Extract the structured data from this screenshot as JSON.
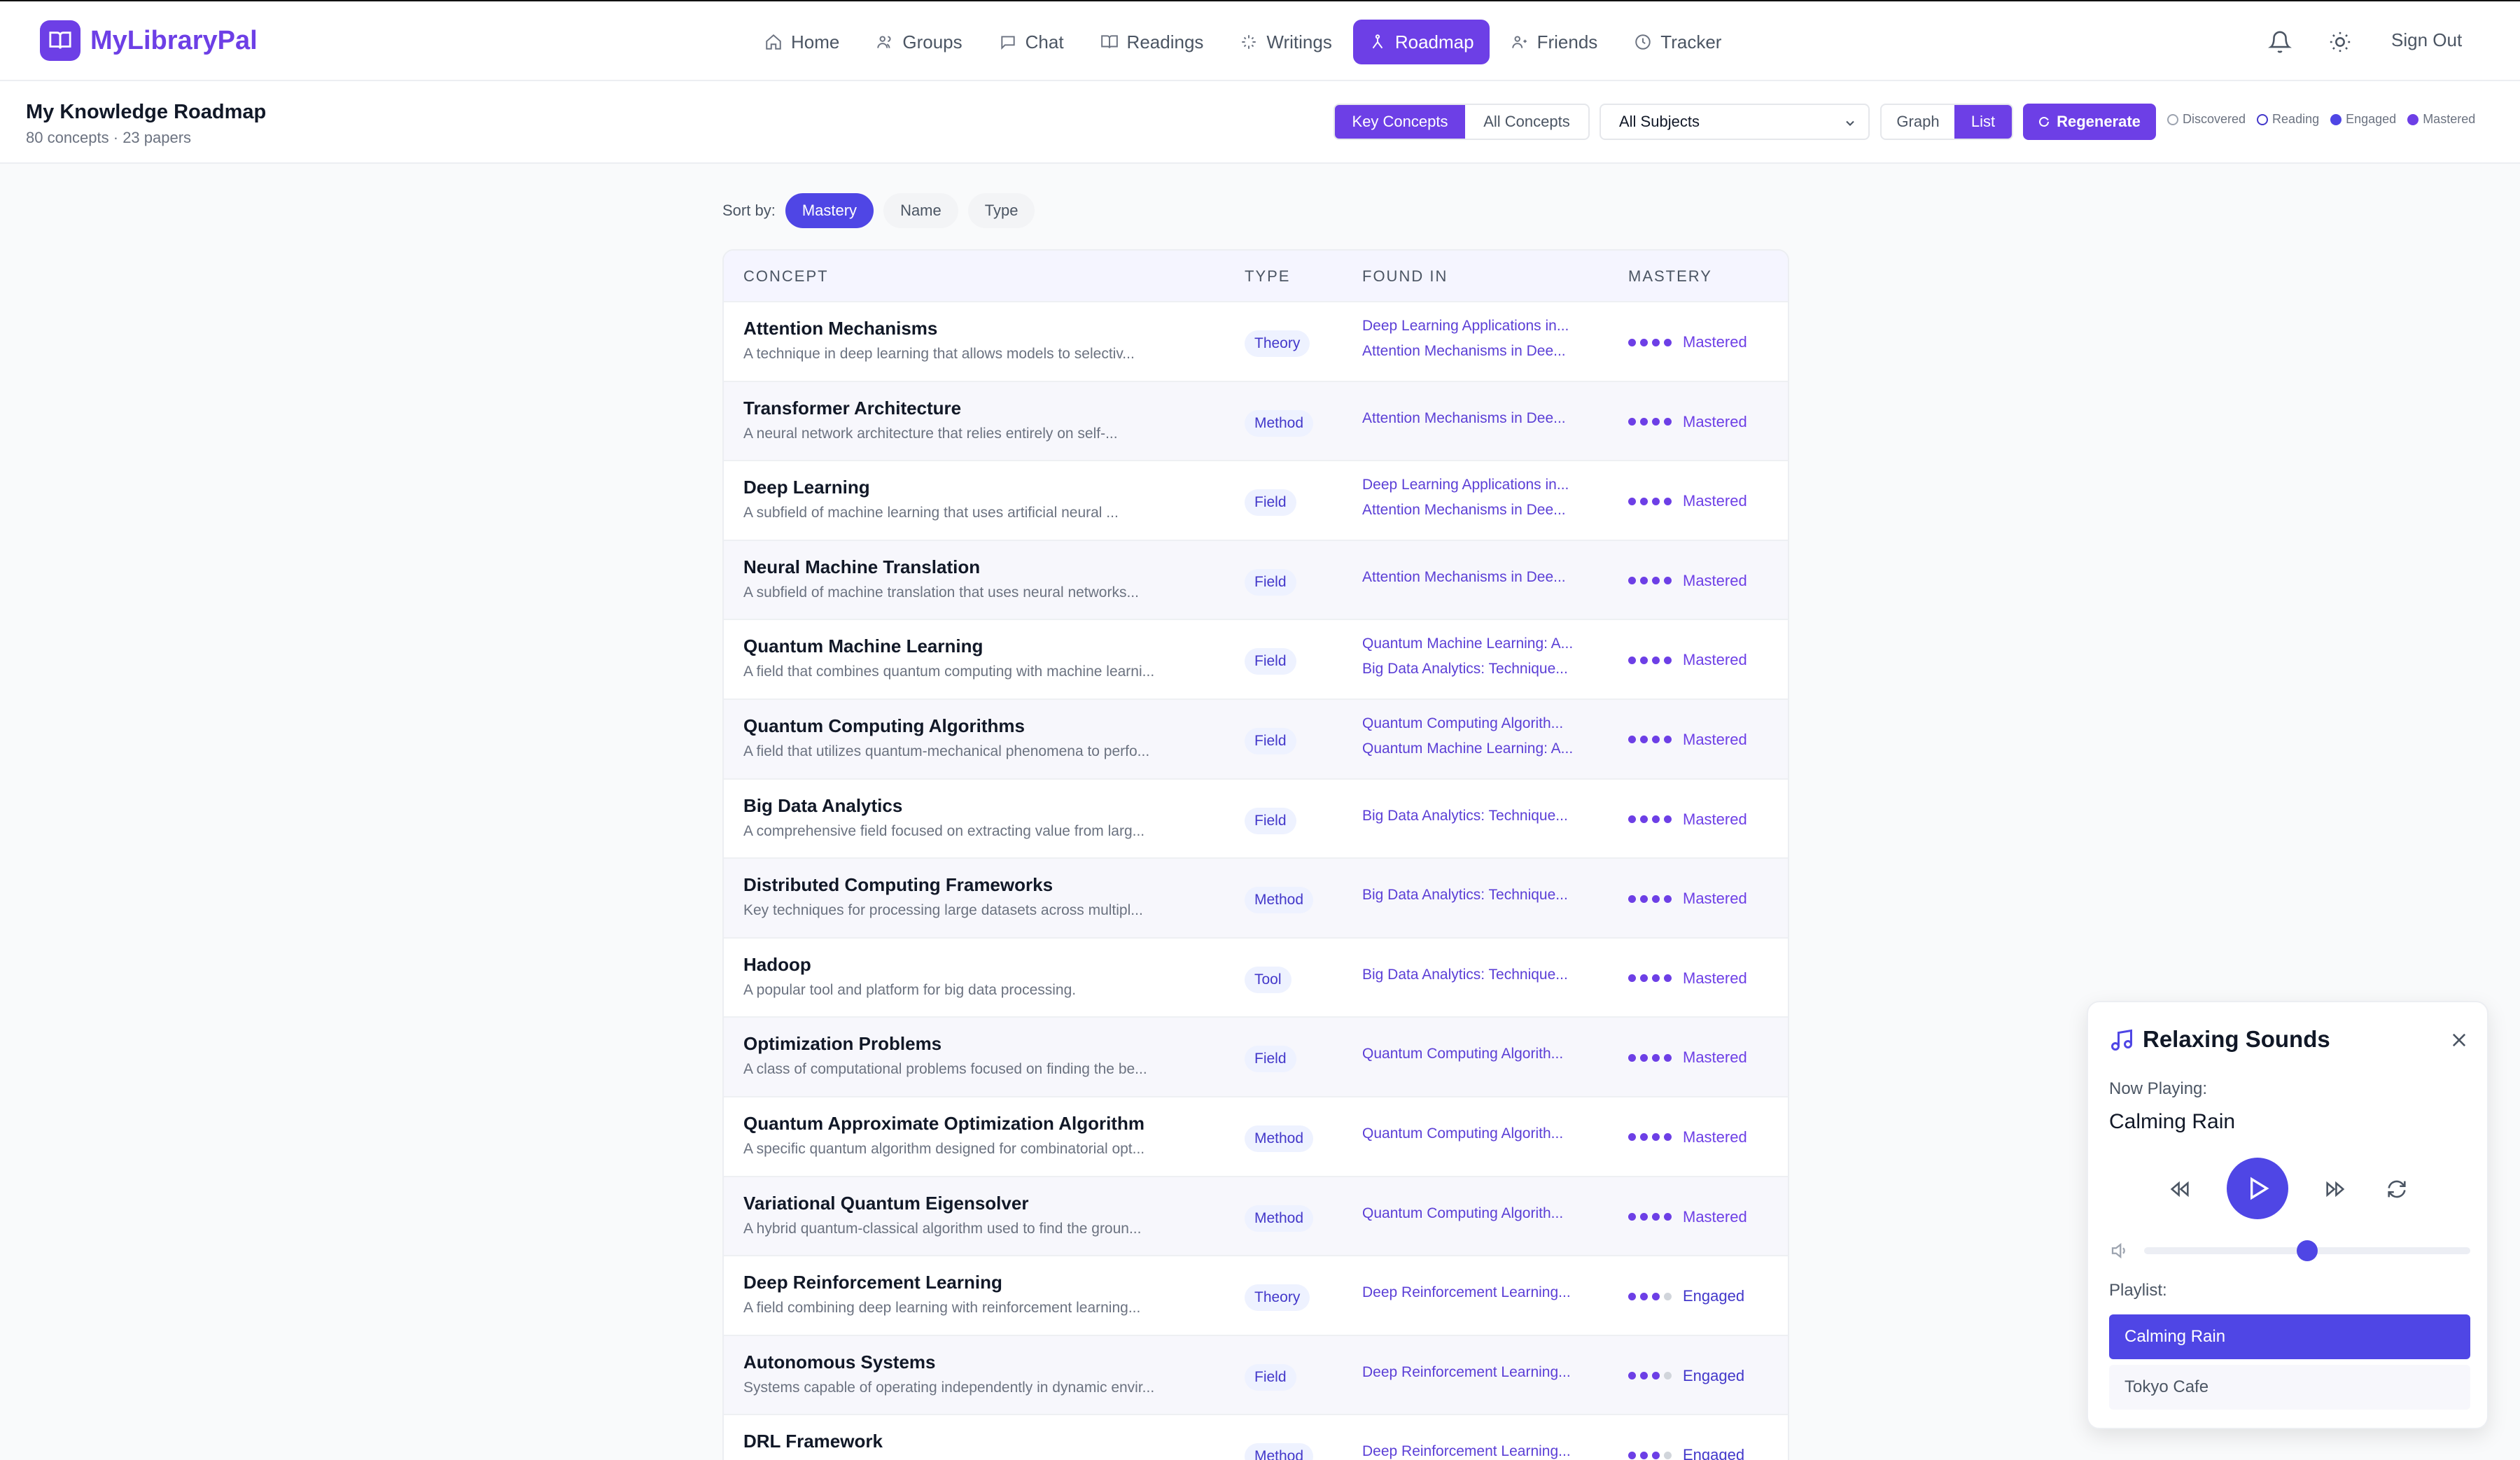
{
  "app": {
    "name": "MyLibraryPal"
  },
  "nav": [
    {
      "label": "Home",
      "icon": "home-icon"
    },
    {
      "label": "Groups",
      "icon": "groups-icon"
    },
    {
      "label": "Chat",
      "icon": "chat-icon"
    },
    {
      "label": "Readings",
      "icon": "book-icon"
    },
    {
      "label": "Writings",
      "icon": "sparkle-icon"
    },
    {
      "label": "Roadmap",
      "icon": "roadmap-icon",
      "active": true
    },
    {
      "label": "Friends",
      "icon": "friends-icon"
    },
    {
      "label": "Tracker",
      "icon": "clock-icon"
    }
  ],
  "header": {
    "sign_out": "Sign Out"
  },
  "page": {
    "title": "My Knowledge Roadmap",
    "subtitle": "80 concepts · 23 papers",
    "filter_key": "Key Concepts",
    "filter_all": "All Concepts",
    "subject_select": "All Subjects",
    "view_graph": "Graph",
    "view_list": "List",
    "regenerate": "Regenerate",
    "legend": [
      {
        "label": "Discovered",
        "color": "#9ca3af"
      },
      {
        "label": "Reading",
        "color": "#4338ca"
      },
      {
        "label": "Engaged",
        "color": "#4f46e5"
      },
      {
        "label": "Mastered",
        "color": "#6d3fe6"
      }
    ]
  },
  "sort": {
    "label": "Sort by:",
    "options": [
      "Mastery",
      "Name",
      "Type"
    ],
    "active": "Mastery"
  },
  "table": {
    "headers": [
      "CONCEPT",
      "TYPE",
      "FOUND IN",
      "MASTERY"
    ],
    "rows": [
      {
        "name": "Attention Mechanisms",
        "desc": "A technique in deep learning that allows models to selectiv...",
        "type": "Theory",
        "found": [
          "Deep Learning Applications in...",
          "Attention Mechanisms in Dee..."
        ],
        "level": 4,
        "mastery": "Mastered"
      },
      {
        "name": "Transformer Architecture",
        "desc": "A neural network architecture that relies entirely on self-...",
        "type": "Method",
        "found": [
          "Attention Mechanisms in Dee..."
        ],
        "level": 4,
        "mastery": "Mastered"
      },
      {
        "name": "Deep Learning",
        "desc": "A subfield of machine learning that uses artificial neural ...",
        "type": "Field",
        "found": [
          "Deep Learning Applications in...",
          "Attention Mechanisms in Dee..."
        ],
        "level": 4,
        "mastery": "Mastered"
      },
      {
        "name": "Neural Machine Translation",
        "desc": "A subfield of machine translation that uses neural networks...",
        "type": "Field",
        "found": [
          "Attention Mechanisms in Dee..."
        ],
        "level": 4,
        "mastery": "Mastered"
      },
      {
        "name": "Quantum Machine Learning",
        "desc": "A field that combines quantum computing with machine learni...",
        "type": "Field",
        "found": [
          "Quantum Machine Learning: A...",
          "Big Data Analytics: Technique..."
        ],
        "level": 4,
        "mastery": "Mastered"
      },
      {
        "name": "Quantum Computing Algorithms",
        "desc": "A field that utilizes quantum-mechanical phenomena to perfo...",
        "type": "Field",
        "found": [
          "Quantum Computing Algorith...",
          "Quantum Machine Learning: A..."
        ],
        "level": 4,
        "mastery": "Mastered"
      },
      {
        "name": "Big Data Analytics",
        "desc": "A comprehensive field focused on extracting value from larg...",
        "type": "Field",
        "found": [
          "Big Data Analytics: Technique..."
        ],
        "level": 4,
        "mastery": "Mastered"
      },
      {
        "name": "Distributed Computing Frameworks",
        "desc": "Key techniques for processing large datasets across multipl...",
        "type": "Method",
        "found": [
          "Big Data Analytics: Technique..."
        ],
        "level": 4,
        "mastery": "Mastered"
      },
      {
        "name": "Hadoop",
        "desc": "A popular tool and platform for big data processing.",
        "type": "Tool",
        "found": [
          "Big Data Analytics: Technique..."
        ],
        "level": 4,
        "mastery": "Mastered"
      },
      {
        "name": "Optimization Problems",
        "desc": "A class of computational problems focused on finding the be...",
        "type": "Field",
        "found": [
          "Quantum Computing Algorith..."
        ],
        "level": 4,
        "mastery": "Mastered"
      },
      {
        "name": "Quantum Approximate Optimization Algorithm",
        "desc": "A specific quantum algorithm designed for combinatorial opt...",
        "type": "Method",
        "found": [
          "Quantum Computing Algorith..."
        ],
        "level": 4,
        "mastery": "Mastered"
      },
      {
        "name": "Variational Quantum Eigensolver",
        "desc": "A hybrid quantum-classical algorithm used to find the groun...",
        "type": "Method",
        "found": [
          "Quantum Computing Algorith..."
        ],
        "level": 4,
        "mastery": "Mastered"
      },
      {
        "name": "Deep Reinforcement Learning",
        "desc": "A field combining deep learning with reinforcement learning...",
        "type": "Theory",
        "found": [
          "Deep Reinforcement Learning..."
        ],
        "level": 3,
        "mastery": "Engaged"
      },
      {
        "name": "Autonomous Systems",
        "desc": "Systems capable of operating independently in dynamic envir...",
        "type": "Field",
        "found": [
          "Deep Reinforcement Learning..."
        ],
        "level": 3,
        "mastery": "Engaged"
      },
      {
        "name": "DRL Framework",
        "desc": "",
        "type": "Method",
        "found": [
          "Deep Reinforcement Learning..."
        ],
        "level": 3,
        "mastery": "Engaged"
      }
    ]
  },
  "player": {
    "title": "Relaxing Sounds",
    "now_playing_label": "Now Playing:",
    "track": "Calming Rain",
    "volume": 0.5,
    "playlist_label": "Playlist:",
    "playlist": [
      "Calming Rain",
      "Tokyo Cafe"
    ],
    "active_track": "Calming Rain"
  }
}
